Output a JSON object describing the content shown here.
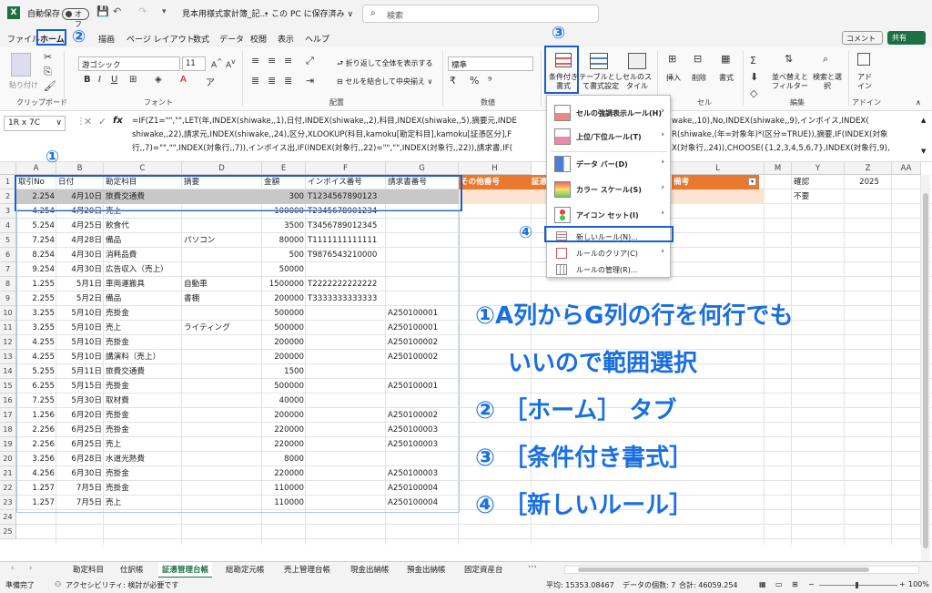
{
  "titlebar": {
    "autosave_label": "自動保存",
    "autosave_state": "オフ",
    "filename": "見本用様式家計簿_記...",
    "save_location": "• この PC に保存済み ∨",
    "search_placeholder": "検索"
  },
  "menubar": {
    "items": [
      "ファイル",
      "ホーム",
      "挿入",
      "描画",
      "ページ レイアウト",
      "数式",
      "データ",
      "校閲",
      "表示",
      "ヘルプ"
    ],
    "comment": "コメント",
    "share": "共有"
  },
  "ribbon": {
    "paste": "貼り付け",
    "clipboard": "クリップボード",
    "font_name": "游ゴシック",
    "font_size": "11",
    "font_group": "フォント",
    "wrap_text": "折り返して全体を表示する",
    "merge_center": "セルを結合して中央揃え",
    "alignment_group": "配置",
    "number_format": "標準",
    "number_group": "数値",
    "cond_format": "条件付き書式",
    "table_format": "テーブルとして書式設定",
    "cell_style": "セルのスタイル",
    "insert": "挿入",
    "delete": "削除",
    "format": "書式",
    "cells_group": "セル",
    "sort_filter": "並べ替えとフィルター",
    "find_select": "検索と選択",
    "editing_group": "編集",
    "addin": "アドイン",
    "addin_group": "アドイン"
  },
  "formulabar": {
    "namebox": "1R x 7C",
    "fx": "fx",
    "line1": "=IF(Z1=\"\",\"\",LET(年,INDEX(shiwake,,1),日付,INDEX(shiwake,,2),科目,INDEX(shiwake,,5),摘要元,INDE",
    "line1b": "wake,,10),No,INDEX(shiwake,,9),インボイス,INDEX(",
    "line2": "shiwake,,22),請求元,INDEX(shiwake,,24),区分,XLOOKUP(科目,kamoku[勘定科目],kamoku[証憑区分],F",
    "line2b": "R(shiwake,(年=対象年)*(区分=TRUE)),摘要,IF(INDEX(対象",
    "line3": "行,,7)=\"\",\"\",INDEX(対象行,,7)),インボイス出,IF(INDEX(対象行,,22)=\"\",\"\",INDEX(対象行,,22)),請求書,IF(",
    "line3b": "X(対象行,,24)),CHOOSE({1,2,3,4,5,6,7},INDEX(対象行,9),"
  },
  "columns": [
    "A",
    "B",
    "C",
    "D",
    "E",
    "F",
    "G",
    "H",
    "L",
    "M",
    "Y",
    "Z",
    "AA"
  ],
  "headers": [
    "取引No",
    "日付",
    "勘定科目",
    "摘要",
    "金額",
    "インボイス番号",
    "請求書番号",
    "その他番号",
    "証憑",
    "備考"
  ],
  "extra": {
    "y1": "確認",
    "z1": "2025",
    "y2": "不要"
  },
  "rows": [
    [
      "2.254",
      "4月10日",
      "旅費交通費",
      "",
      "300",
      "T1234567890123",
      ""
    ],
    [
      "4.254",
      "4月20日",
      "売上",
      "",
      "100000",
      "T2345678901234",
      ""
    ],
    [
      "5.254",
      "4月25日",
      "飲食代",
      "",
      "3500",
      "T3456789012345",
      ""
    ],
    [
      "7.254",
      "4月28日",
      "備品",
      "パソコン",
      "80000",
      "T1111111111111",
      ""
    ],
    [
      "8.254",
      "4月30日",
      "消耗品費",
      "",
      "500",
      "T9876543210000",
      ""
    ],
    [
      "9.254",
      "4月30日",
      "広告収入（売上）",
      "",
      "50000",
      "",
      ""
    ],
    [
      "1.255",
      "5月1日",
      "車両運搬具",
      "自動車",
      "1500000",
      "T2222222222222",
      ""
    ],
    [
      "2.255",
      "5月2日",
      "備品",
      "書棚",
      "200000",
      "T3333333333333",
      ""
    ],
    [
      "3.255",
      "5月10日",
      "売掛金",
      "",
      "500000",
      "",
      "A250100001"
    ],
    [
      "3.255",
      "5月10日",
      "売上",
      "ライティング",
      "500000",
      "",
      "A250100001"
    ],
    [
      "4.255",
      "5月10日",
      "売掛金",
      "",
      "200000",
      "",
      "A250100002"
    ],
    [
      "4.255",
      "5月10日",
      "講演料（売上）",
      "",
      "200000",
      "",
      "A250100002"
    ],
    [
      "5.255",
      "5月11日",
      "旅費交通費",
      "",
      "1500",
      "",
      ""
    ],
    [
      "6.255",
      "5月15日",
      "売掛金",
      "",
      "500000",
      "",
      "A250100001"
    ],
    [
      "7.255",
      "5月30日",
      "取材費",
      "",
      "40000",
      "",
      ""
    ],
    [
      "1.256",
      "6月20日",
      "売掛金",
      "",
      "200000",
      "",
      "A250100002"
    ],
    [
      "2.256",
      "6月25日",
      "売掛金",
      "",
      "220000",
      "",
      "A250100003"
    ],
    [
      "2.256",
      "6月25日",
      "売上",
      "",
      "220000",
      "",
      "A250100003"
    ],
    [
      "3.256",
      "6月28日",
      "水道光熱費",
      "",
      "8000",
      "",
      ""
    ],
    [
      "4.256",
      "6月30日",
      "売掛金",
      "",
      "220000",
      "",
      "A250100003"
    ],
    [
      "1.257",
      "7月5日",
      "売掛金",
      "",
      "110000",
      "",
      "A250100004"
    ],
    [
      "1.257",
      "7月5日",
      "売上",
      "",
      "110000",
      "",
      "A250100004"
    ]
  ],
  "dropdown": {
    "items": [
      {
        "label": "セルの強調表示ルール(H)",
        "arrow": "›"
      },
      {
        "label": "上位/下位ルール(T)",
        "arrow": "›"
      },
      {
        "label": "データ バー(D)",
        "arrow": "›"
      },
      {
        "label": "カラー スケール(S)",
        "arrow": "›"
      },
      {
        "label": "アイコン セット(I)",
        "arrow": "›"
      }
    ],
    "new_rule": "新しいルール(N)...",
    "clear_rules": "ルールのクリア(C)",
    "manage_rules": "ルールの管理(R)..."
  },
  "annotations": {
    "n1": "①",
    "n2": "②",
    "n3": "③",
    "n4": "④",
    "line1": "①A列からG列の行を何行でも",
    "line2": "いいので範囲選択",
    "line3": "② ［ホーム］ タブ",
    "line4": "③ ［条件付き書式］",
    "line5": "④ ［新しいルール］"
  },
  "sheet_tabs": [
    "勘定科目",
    "仕訳帳",
    "証憑管理台帳",
    "総勘定元帳",
    "売上管理台帳",
    "現金出納帳",
    "預金出納帳",
    "固定資産台"
  ],
  "status": {
    "ready": "準備完了",
    "accessibility": "アクセシビリティ: 検討が必要です",
    "average": "平均: 15353.08467",
    "count": "データの個数: 7",
    "sum": "合計: 46059.254",
    "zoom": "100%"
  },
  "colors": {
    "accent": "#1a6fe0",
    "header_orange": "#e8792e",
    "selected_row": "#c8c8c8"
  }
}
